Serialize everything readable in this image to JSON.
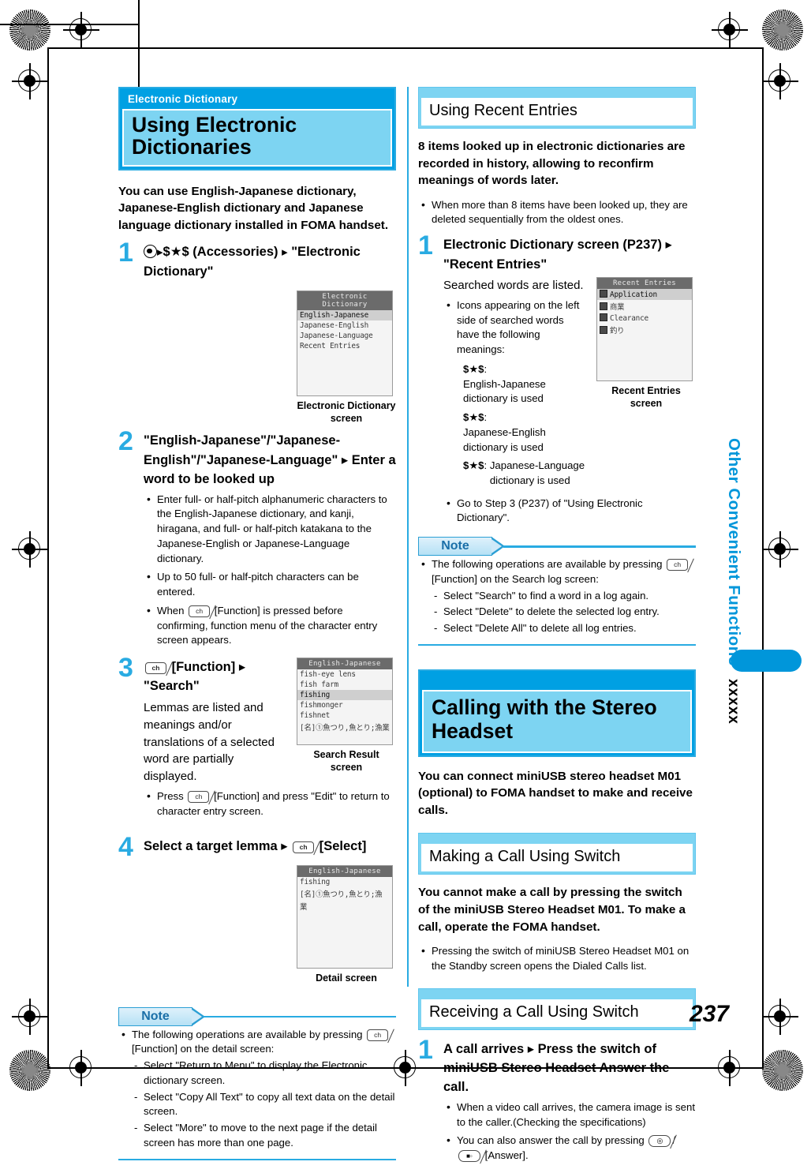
{
  "page": {
    "number": "237",
    "side_tab_label": "Other Convenient Functions",
    "side_tab_placeholder": "xxxxx",
    "accent_blue": "#00A0E3",
    "light_blue": "#7DD4F2",
    "rule_blue": "#29ABE2"
  },
  "left": {
    "chapter": {
      "kicker": "Electronic Dictionary",
      "title": "Using Electronic Dictionaries"
    },
    "lead": "You can use English-Japanese dictionary, Japanese-English dictionary and Japanese language dictionary installed in FOMA handset.",
    "steps": [
      {
        "num": "1",
        "title_a": "(Accessories)",
        "title_b": "\"Electronic Dictionary\"",
        "key_sequence": "$★$"
      },
      {
        "num": "2",
        "title": "\"English-Japanese\"/\"Japanese-English\"/\"Japanese-Language\" ▸ Enter a word to be looked up",
        "bullets": [
          "Enter full- or half-pitch alphanumeric characters to the English-Japanese dictionary, and kanji, hiragana, and full- or half-pitch katakana to the Japanese-English or Japanese-Language dictionary.",
          "Up to 50 full- or half-pitch characters can be entered."
        ],
        "bullet_key_pre": "When",
        "bullet_key_post": "[Function] is pressed before confirming, function menu of the character entry screen appears."
      },
      {
        "num": "3",
        "title_post": "[Function] ▸ \"Search\"",
        "body": "Lemmas are listed and meanings and/or translations of a selected word are partially displayed.",
        "bullet_pre": "Press",
        "bullet_post": "[Function] and press \"Edit\" to return to character entry screen."
      },
      {
        "num": "4",
        "title_pre": "Select a target lemma ▸",
        "title_post": "[Select]"
      }
    ],
    "screens": [
      {
        "caption": "Electronic Dictionary screen",
        "titlebar": "Electronic Dictionary",
        "rows": [
          "English-Japanese",
          "Japanese-English",
          "Japanese-Language",
          "Recent Entries"
        ],
        "selected_index": 0
      },
      {
        "caption": "Search Result screen",
        "titlebar": "English-Japanese",
        "rows": [
          "fish-eye lens",
          "fish farm",
          "fishing",
          "fishmonger",
          "fishnet",
          "[名]①魚つり,魚とり;漁業"
        ],
        "selected_index": 2
      },
      {
        "caption": "Detail screen",
        "titlebar": "English-Japanese",
        "rows": [
          "fishing",
          "[名]①魚つり,魚とり;漁",
          "業"
        ],
        "selected_index": -1
      }
    ],
    "note": {
      "label": "Note",
      "intro_pre": "The following operations are available by pressing",
      "intro_post": "[Function] on the detail screen:",
      "items": [
        "Select \"Return to Menu\" to display the Electronic dictionary screen.",
        "Select \"Copy All Text\" to copy all text data on the detail screen.",
        "Select \"More\" to move to the next page if the detail screen has more than one page."
      ]
    }
  },
  "right": {
    "recent": {
      "header": "Using Recent Entries",
      "lead": "8 items looked up in electronic dictionaries are recorded in history, allowing to reconfirm meanings of words later.",
      "bullets": [
        "When more than 8 items have been looked up, they are deleted sequentially from the oldest ones."
      ],
      "step": {
        "num": "1",
        "title": "Electronic Dictionary screen (P237) ▸ \"Recent Entries\"",
        "body": "Searched words are listed.",
        "icon_intro": "Icons appearing on the left side of searched words have the following meanings:",
        "icon_items": [
          {
            "glyph": "$★$",
            "text": "English-Japanese dictionary is used"
          },
          {
            "glyph": "$★$",
            "text": "Japanese-English dictionary is used"
          },
          {
            "glyph": "$★$",
            "text": "Japanese-Language dictionary is used"
          }
        ],
        "goto": "Go to Step 3 (P237) of \"Using Electronic Dictionary\"."
      },
      "screen": {
        "caption": "Recent Entries screen",
        "titlebar": "Recent Entries",
        "rows": [
          "Application",
          "商業",
          "Clearance",
          "釣り"
        ],
        "selected_index": 0
      },
      "note": {
        "label": "Note",
        "intro_pre": "The following operations are available by pressing",
        "intro_post": "[Function] on the Search log screen:",
        "items": [
          "Select \"Search\" to find a word in a log again.",
          "Select \"Delete\" to delete the selected log entry.",
          "Select \"Delete All\" to delete all log entries."
        ]
      }
    },
    "headset": {
      "title": "Calling with the Stereo Headset",
      "lead": "You can connect miniUSB stereo headset M01 (optional) to FOMA handset to make and receive calls.",
      "making": {
        "header": "Making a Call Using Switch",
        "lead": "You cannot make a call by pressing the switch of the miniUSB Stereo Headset M01. To make a call, operate the FOMA handset.",
        "bullets": [
          "Pressing the switch of miniUSB Stereo Headset M01 on the Standby screen opens the Dialed Calls list."
        ]
      },
      "receiving": {
        "header": "Receiving a Call Using Switch",
        "step": {
          "num": "1",
          "title": "A call arrives ▸ Press the switch of miniUSB Stereo Headset Answer the call.",
          "bullet1": "When a video call arrives, the camera image is sent to the caller.(Checking the specifications)",
          "bullet2_pre": "You can also answer the call by pressing",
          "bullet2_post": "[Answer]."
        }
      }
    }
  }
}
